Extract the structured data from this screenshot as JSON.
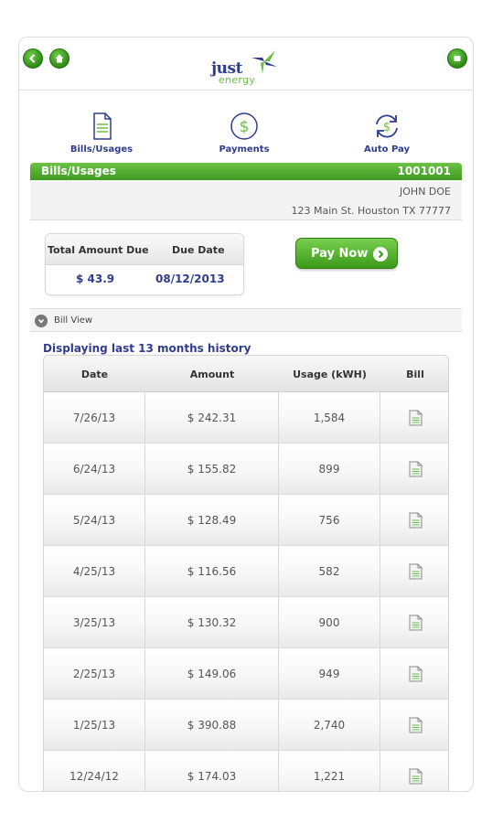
{
  "header": {
    "back_icon": "back-arrow-icon",
    "home_icon": "home-icon",
    "menu_icon": "menu-icon",
    "logo_word_1": "just",
    "logo_word_2": "energy"
  },
  "nav": {
    "items": [
      {
        "label": "Bills/Usages",
        "icon": "document-icon"
      },
      {
        "label": "Payments",
        "icon": "dollar-circle-icon"
      },
      {
        "label": "Auto Pay",
        "icon": "autopay-refresh-icon"
      }
    ]
  },
  "section": {
    "title": "Bills/Usages",
    "account_number": "1001001"
  },
  "account": {
    "name": "JOHN DOE",
    "address": "123 Main St.  Houston  TX  77777"
  },
  "due": {
    "total_label": "Total Amount Due",
    "date_label": "Due Date",
    "amount": "$ 43.9",
    "date": "08/12/2013"
  },
  "pay_button": "Pay Now",
  "bill_view_label": "Bill View",
  "history_label": "Displaying last 13 months history",
  "table": {
    "columns": [
      "Date",
      "Amount",
      "Usage (kWH)",
      "Bill"
    ],
    "rows": [
      {
        "date": "7/26/13",
        "amount": "$ 242.31",
        "usage": "1,584"
      },
      {
        "date": "6/24/13",
        "amount": "$ 155.82",
        "usage": "899"
      },
      {
        "date": "5/24/13",
        "amount": "$ 128.49",
        "usage": "756"
      },
      {
        "date": "4/25/13",
        "amount": "$ 116.56",
        "usage": "582"
      },
      {
        "date": "3/25/13",
        "amount": "$ 130.32",
        "usage": "900"
      },
      {
        "date": "2/25/13",
        "amount": "$ 149.06",
        "usage": "949"
      },
      {
        "date": "1/25/13",
        "amount": "$ 390.88",
        "usage": "2,740"
      },
      {
        "date": "12/24/12",
        "amount": "$ 174.03",
        "usage": "1,221"
      }
    ]
  },
  "colors": {
    "brand_green": "#4aa826",
    "brand_blue": "#2e3d8f"
  }
}
